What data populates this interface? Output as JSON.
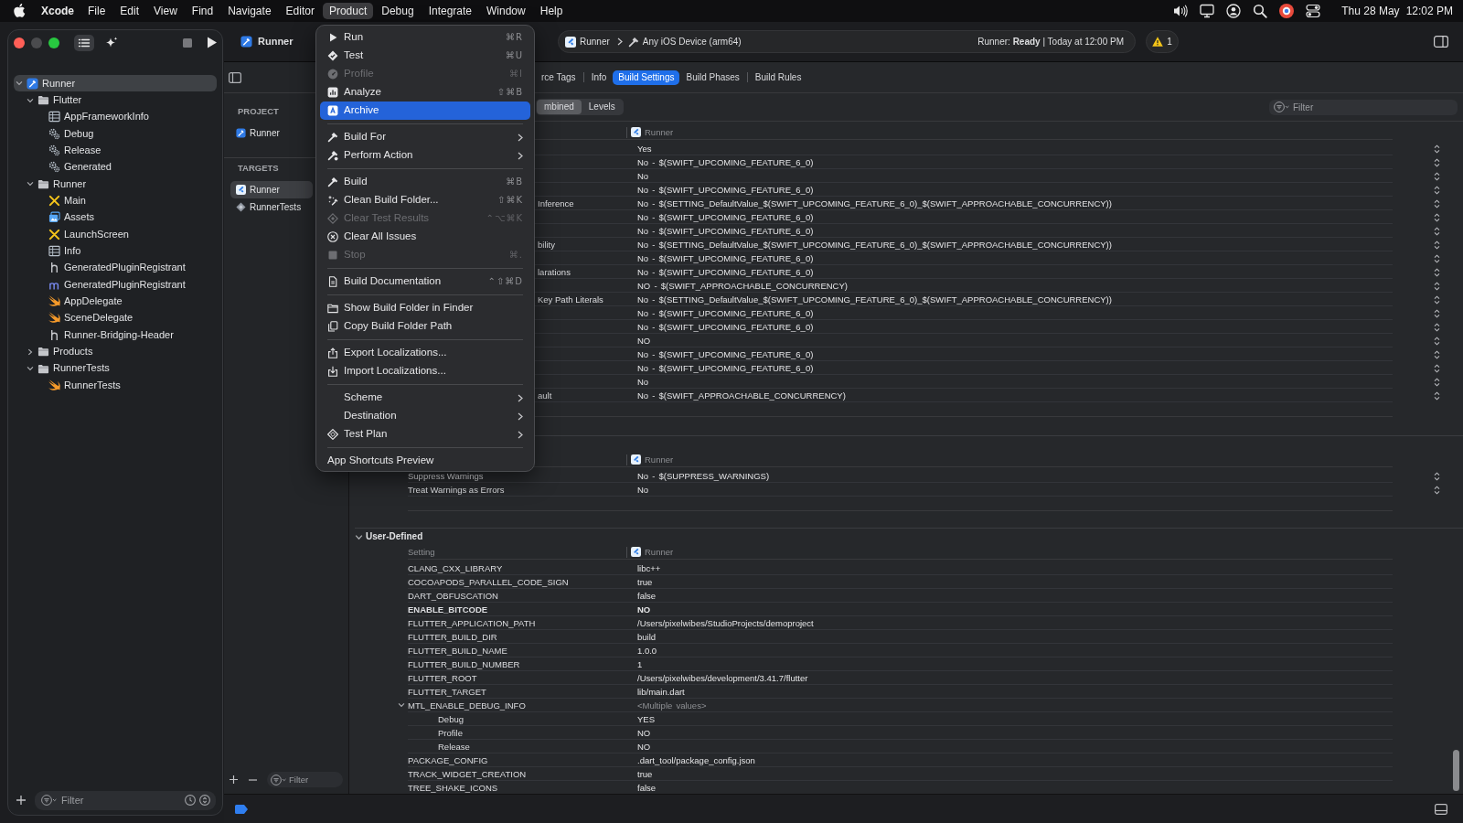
{
  "menubar": {
    "app": "Xcode",
    "items": [
      {
        "label": "File",
        "selected": false
      },
      {
        "label": "Edit",
        "selected": false
      },
      {
        "label": "View",
        "selected": false
      },
      {
        "label": "Find",
        "selected": false
      },
      {
        "label": "Navigate",
        "selected": false
      },
      {
        "label": "Editor",
        "selected": false
      },
      {
        "label": "Product",
        "selected": true
      },
      {
        "label": "Debug",
        "selected": false
      },
      {
        "label": "Integrate",
        "selected": false
      },
      {
        "label": "Window",
        "selected": false
      },
      {
        "label": "Help",
        "selected": false
      }
    ],
    "date": "Thu 28 May",
    "time": "12:02 PM"
  },
  "toolbar": {
    "project": "Runner",
    "scheme": "Runner",
    "destination": "Any iOS Device (arm64)",
    "status": "Runner: **Ready** | Today at 12:00 PM",
    "warnings": "1"
  },
  "product_menu": {
    "groups": [
      [
        {
          "label": "Run",
          "shortcut": "⌘R",
          "disabled": false,
          "selected": false,
          "submenu": false
        },
        {
          "label": "Test",
          "shortcut": "⌘U",
          "disabled": false,
          "selected": false,
          "submenu": false
        },
        {
          "label": "Profile",
          "shortcut": "⌘I",
          "disabled": true,
          "selected": false,
          "submenu": false
        },
        {
          "label": "Analyze",
          "shortcut": "⇧⌘B",
          "disabled": false,
          "selected": false,
          "submenu": false
        },
        {
          "label": "Archive",
          "disabled": false,
          "selected": true,
          "submenu": false
        }
      ],
      [
        {
          "label": "Build For",
          "disabled": false,
          "selected": false,
          "submenu": true
        },
        {
          "label": "Perform Action",
          "disabled": false,
          "selected": false,
          "submenu": true
        }
      ],
      [
        {
          "label": "Build",
          "shortcut": "⌘B",
          "disabled": false,
          "selected": false,
          "submenu": false
        },
        {
          "label": "Clean Build Folder...",
          "shortcut": "⇧⌘K",
          "disabled": false,
          "selected": false,
          "submenu": false
        },
        {
          "label": "Clear Test Results",
          "shortcut": "⌃⌥⌘K",
          "disabled": true,
          "selected": false,
          "submenu": false
        },
        {
          "label": "Clear All Issues",
          "disabled": false,
          "selected": false,
          "submenu": false
        },
        {
          "label": "Stop",
          "shortcut": "⌘.",
          "disabled": true,
          "selected": false,
          "submenu": false
        }
      ],
      [
        {
          "label": "Build Documentation",
          "shortcut": "⌃⇧⌘D",
          "disabled": false,
          "selected": false,
          "submenu": false
        }
      ],
      [
        {
          "label": "Show Build Folder in Finder",
          "disabled": false,
          "selected": false,
          "submenu": false
        },
        {
          "label": "Copy Build Folder Path",
          "disabled": false,
          "selected": false,
          "submenu": false
        }
      ],
      [
        {
          "label": "Export Localizations...",
          "disabled": false,
          "selected": false,
          "submenu": false
        },
        {
          "label": "Import Localizations...",
          "disabled": false,
          "selected": false,
          "submenu": false
        }
      ],
      [
        {
          "label": "Scheme",
          "disabled": false,
          "selected": false,
          "submenu": true
        },
        {
          "label": "Destination",
          "disabled": false,
          "selected": false,
          "submenu": true
        },
        {
          "label": "Test Plan",
          "disabled": false,
          "selected": false,
          "submenu": true
        }
      ],
      [
        {
          "label": "App Shortcuts Preview",
          "disabled": false,
          "selected": false,
          "submenu": false
        }
      ]
    ]
  },
  "navigator": {
    "tree": [
      {
        "label": "Runner",
        "kind": "project",
        "selected": true,
        "expanded": true,
        "children": [
          {
            "label": "Flutter",
            "kind": "folder",
            "selected": false,
            "expanded": true,
            "children": [
              {
                "label": "AppFrameworkInfo",
                "kind": "plist",
                "selected": false
              },
              {
                "label": "Debug",
                "kind": "xcconfig",
                "selected": false
              },
              {
                "label": "Release",
                "kind": "xcconfig",
                "selected": false
              },
              {
                "label": "Generated",
                "kind": "xcconfig",
                "selected": false
              }
            ]
          },
          {
            "label": "Runner",
            "kind": "folder",
            "selected": false,
            "expanded": true,
            "children": [
              {
                "label": "Main",
                "kind": "storyboard",
                "selected": false
              },
              {
                "label": "Assets",
                "kind": "assets",
                "selected": false
              },
              {
                "label": "LaunchScreen",
                "kind": "storyboard",
                "selected": false
              },
              {
                "label": "Info",
                "kind": "plist",
                "selected": false
              },
              {
                "label": "GeneratedPluginRegistrant",
                "kind": "header",
                "selected": false
              },
              {
                "label": "GeneratedPluginRegistrant",
                "kind": "objc",
                "selected": false
              },
              {
                "label": "AppDelegate",
                "kind": "swift",
                "selected": false
              },
              {
                "label": "SceneDelegate",
                "kind": "swift",
                "selected": false
              },
              {
                "label": "Runner-Bridging-Header",
                "kind": "header",
                "selected": false
              }
            ]
          },
          {
            "label": "Products",
            "kind": "folder",
            "selected": false,
            "expanded": false
          },
          {
            "label": "RunnerTests",
            "kind": "folder",
            "selected": false,
            "expanded": true,
            "children": [
              {
                "label": "RunnerTests",
                "kind": "swift",
                "selected": false
              }
            ]
          }
        ]
      }
    ],
    "filter": {
      "placeholder": "Filter"
    }
  },
  "targets_panel": {
    "sections": [
      {
        "heading": "PROJECT",
        "items": [
          {
            "label": "Runner",
            "kind": "project",
            "selected": false
          }
        ]
      },
      {
        "heading": "TARGETS",
        "items": [
          {
            "label": "Runner",
            "kind": "app",
            "selected": true
          },
          {
            "label": "RunnerTests",
            "kind": "tests",
            "selected": false
          }
        ]
      }
    ],
    "filter": {
      "placeholder": "Filter"
    }
  },
  "editor": {
    "tabs": [
      {
        "label": "rce Tags",
        "selected": false
      },
      {
        "label": "Info",
        "selected": false
      },
      {
        "label": "Build Settings",
        "selected": true
      },
      {
        "label": "Build Phases",
        "selected": false
      },
      {
        "label": "Build Rules",
        "selected": false
      }
    ],
    "modes": [
      {
        "label": "mbined",
        "selected": true
      },
      {
        "label": "Levels",
        "selected": false
      }
    ],
    "filter": {
      "placeholder": "Filter"
    },
    "sections": [
      {
        "header": {
          "target": "Runner"
        },
        "rows": [
          {
            "value": "Yes",
            "popup": true
          },
          {
            "value": "No - $(SWIFT_UPCOMING_FEATURE_6_0)",
            "popup": true
          },
          {
            "value": "No",
            "popup": true
          },
          {
            "value": "No - $(SWIFT_UPCOMING_FEATURE_6_0)",
            "popup": true
          },
          {
            "setting": "Inference",
            "value": "No - $(SETTING_DefaultValue_$(SWIFT_UPCOMING_FEATURE_6_0)_$(SWIFT_APPROACHABLE_CONCURRENCY))",
            "popup": true
          },
          {
            "value": "No - $(SWIFT_UPCOMING_FEATURE_6_0)",
            "popup": true
          },
          {
            "value": "No - $(SWIFT_UPCOMING_FEATURE_6_0)",
            "popup": true
          },
          {
            "setting": "bility",
            "value": "No - $(SETTING_DefaultValue_$(SWIFT_UPCOMING_FEATURE_6_0)_$(SWIFT_APPROACHABLE_CONCURRENCY))",
            "popup": true
          },
          {
            "value": "No - $(SWIFT_UPCOMING_FEATURE_6_0)",
            "popup": true
          },
          {
            "setting": "larations",
            "value": "No - $(SWIFT_UPCOMING_FEATURE_6_0)",
            "popup": true
          },
          {
            "value": "NO - $(SWIFT_APPROACHABLE_CONCURRENCY)",
            "popup": true
          },
          {
            "setting": "Key Path Literals",
            "value": "No - $(SETTING_DefaultValue_$(SWIFT_UPCOMING_FEATURE_6_0)_$(SWIFT_APPROACHABLE_CONCURRENCY))",
            "popup": true
          },
          {
            "value": "No - $(SWIFT_UPCOMING_FEATURE_6_0)",
            "popup": true
          },
          {
            "value": "No - $(SWIFT_UPCOMING_FEATURE_6_0)",
            "popup": true
          },
          {
            "value": "NO",
            "popup": true
          },
          {
            "value": "No - $(SWIFT_UPCOMING_FEATURE_6_0)",
            "popup": true
          },
          {
            "value": "No - $(SWIFT_UPCOMING_FEATURE_6_0)",
            "popup": true
          },
          {
            "value": "No",
            "popup": true
          },
          {
            "setting": "ault",
            "value": "No - $(SWIFT_APPROACHABLE_CONCURRENCY)",
            "popup": true
          }
        ]
      },
      {
        "header": {
          "target": "Runner"
        },
        "rows": [
          {
            "setting": "Suppress Warnings",
            "value": "No - $(SUPPRESS_WARNINGS)",
            "popup": true
          },
          {
            "setting": "Treat Warnings as Errors",
            "value": "No",
            "popup": true
          }
        ]
      },
      {
        "title": "User-Defined",
        "expanded": true,
        "header": {
          "setting": "Setting",
          "target": "Runner"
        },
        "rows": [
          {
            "setting": "CLANG_CXX_LIBRARY",
            "value": "libc++",
            "emphasized": false
          },
          {
            "setting": "COCOAPODS_PARALLEL_CODE_SIGN",
            "value": "true",
            "emphasized": false
          },
          {
            "setting": "DART_OBFUSCATION",
            "value": "false",
            "emphasized": false
          },
          {
            "setting": "ENABLE_BITCODE",
            "value": "NO",
            "emphasized": true
          },
          {
            "setting": "FLUTTER_APPLICATION_PATH",
            "value": "/Users/pixelwibes/StudioProjects/demoproject",
            "emphasized": false
          },
          {
            "setting": "FLUTTER_BUILD_DIR",
            "value": "build",
            "emphasized": false
          },
          {
            "setting": "FLUTTER_BUILD_NAME",
            "value": "1.0.0",
            "emphasized": false
          },
          {
            "setting": "FLUTTER_BUILD_NUMBER",
            "value": "1",
            "emphasized": false
          },
          {
            "setting": "FLUTTER_ROOT",
            "value": "/Users/pixelwibes/development/3.41.7/flutter",
            "emphasized": false
          },
          {
            "setting": "FLUTTER_TARGET",
            "value": "lib/main.dart",
            "emphasized": false
          },
          {
            "setting": "MTL_ENABLE_DEBUG_INFO",
            "value": "<Multiple values>",
            "emphasized": false,
            "expanded": true,
            "children": [
              {
                "setting": "Debug",
                "value": "YES",
                "emphasized": false
              },
              {
                "setting": "Profile",
                "value": "NO",
                "emphasized": false
              },
              {
                "setting": "Release",
                "value": "NO",
                "emphasized": false
              }
            ]
          },
          {
            "setting": "PACKAGE_CONFIG",
            "value": ".dart_tool/package_config.json",
            "emphasized": false
          },
          {
            "setting": "TRACK_WIDGET_CREATION",
            "value": "true",
            "emphasized": false
          },
          {
            "setting": "TREE_SHAKE_ICONS",
            "value": "false",
            "emphasized": false
          }
        ]
      }
    ]
  }
}
